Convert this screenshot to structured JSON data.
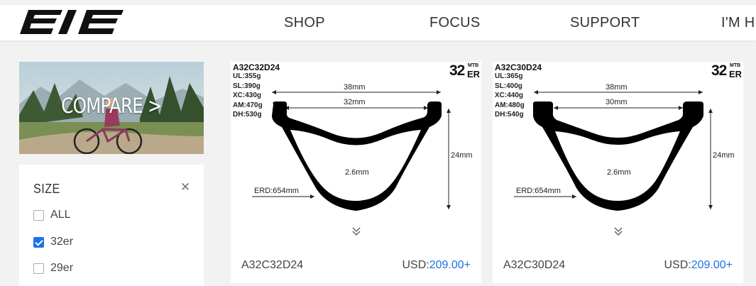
{
  "header": {
    "logo_text": "EIE",
    "nav": [
      {
        "label": "SHOP"
      },
      {
        "label": "FOCUS"
      },
      {
        "label": "SUPPORT"
      },
      {
        "label": "I'M HE"
      }
    ]
  },
  "compare_banner": {
    "label": "COMPARE >"
  },
  "size_filter": {
    "title": "SIZE",
    "close_icon": "close-icon",
    "options": [
      {
        "label": "ALL",
        "checked": false
      },
      {
        "label": "32er",
        "checked": true
      },
      {
        "label": "29er",
        "checked": false
      }
    ]
  },
  "products": [
    {
      "model": "A32C32D24",
      "weights": [
        "UL:355g",
        "SL:390g",
        "XC:430g",
        "AM:470g",
        "DH:530g"
      ],
      "size_number": "32",
      "size_sup": "MTB",
      "size_er": "ER",
      "outer_width": "38mm",
      "inner_width": "32mm",
      "depth": "24mm",
      "thickness": "2.6mm",
      "erd": "ERD:654mm",
      "name": "A32C32D24",
      "price_currency": "USD:",
      "price_value": "209.00+"
    },
    {
      "model": "A32C30D24",
      "weights": [
        "UL:365g",
        "SL:400g",
        "XC:440g",
        "AM:480g",
        "DH:540g"
      ],
      "size_number": "32",
      "size_sup": "MTB",
      "size_er": "ER",
      "outer_width": "38mm",
      "inner_width": "30mm",
      "depth": "24mm",
      "thickness": "2.6mm",
      "erd": "ERD:654mm",
      "name": "A32C30D24",
      "price_currency": "USD:",
      "price_value": "209.00+"
    }
  ],
  "colors": {
    "accent": "#1a73e8",
    "text": "#333333",
    "background": "#f2f2f2"
  }
}
